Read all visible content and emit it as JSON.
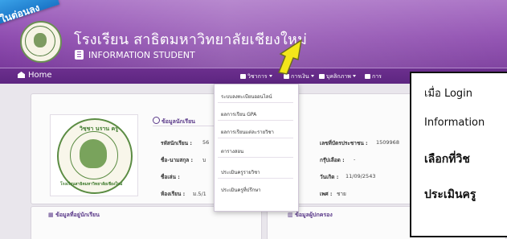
{
  "corner_ribbon": {
    "text": "ในต่อนลง"
  },
  "header": {
    "school_name": "โรงเรียน สาธิตมหาวิทยาลัยเชียงใหม่",
    "subtitle": "INFORMATION STUDENT"
  },
  "navbar": {
    "home_label": "Home",
    "menus": [
      "วิชาการ",
      "การเงิน",
      "บุคลิกภาพ",
      "การ"
    ]
  },
  "dropdown": {
    "items": [
      "ระบบลงทะเบียนออนไลน์",
      "ผลการเรียน GPA",
      "ผลการเรียนแต่ละรายวิชา",
      "ตารางสอน",
      "ประเมินครูรายวิชา",
      "ประเมินครูที่ปรึกษา"
    ]
  },
  "photo_seal": {
    "top_text": "วิชฺชา นราน ครู",
    "bottom_text": "โรงเรียนสาธิตมหาวิทยาลัยเชียงใหม่"
  },
  "student_info": {
    "section_title": "ข้อมูลนักเรียน",
    "left": [
      {
        "label": "รหัสนักเรียน :",
        "value": "56"
      },
      {
        "label": "ชื่อ-นามสกุล :",
        "value": "บ"
      },
      {
        "label": "ชื่อเล่น :",
        "value": ""
      },
      {
        "label": "ห้องเรียน :",
        "value": "ม.5/1"
      }
    ],
    "right": [
      {
        "label": "เลขที่บัตรประชาชน :",
        "value": "1509968"
      },
      {
        "label": "กรุ๊ปเลือด :",
        "value": "-"
      },
      {
        "label": "วันเกิด :",
        "value": "11/09/2543"
      },
      {
        "label": "เพศ :",
        "value": "ชาย"
      }
    ]
  },
  "bottom_sections": {
    "address_title": "ข้อมูลที่อยู่นักเรียน",
    "parent_title": "ข้อมูลผู้ปกครอง"
  },
  "callout": {
    "lines": [
      "เมื่อ Login",
      "Information",
      "เลือกที่วิช",
      "ประเมินครู"
    ]
  },
  "colors": {
    "header_purple": "#8f4db0",
    "navbar_purple": "#5c2580",
    "arrow_yellow": "#f3e61b",
    "ribbon_blue": "#1b76c8"
  }
}
